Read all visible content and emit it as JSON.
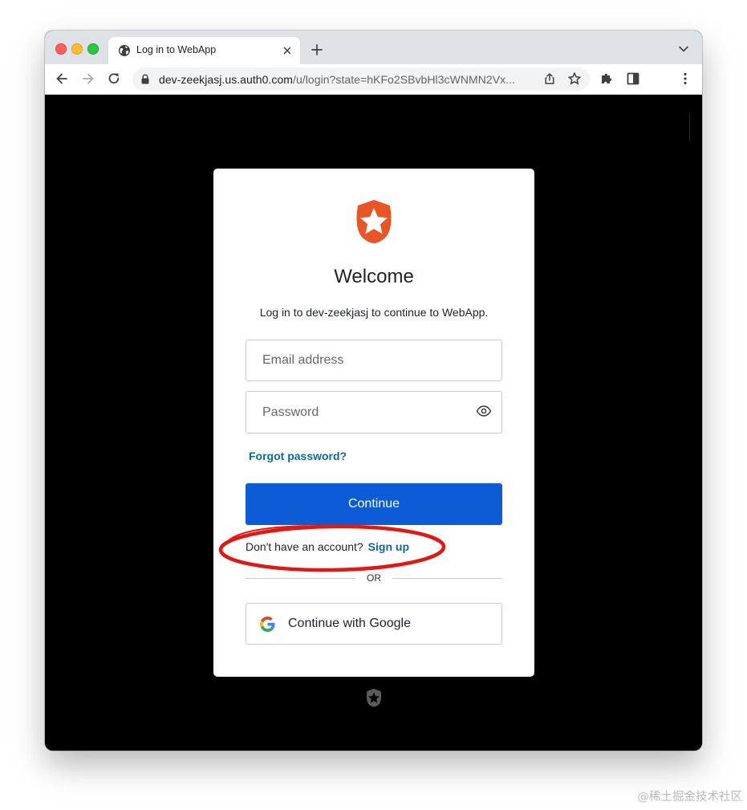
{
  "browser": {
    "tab_title": "Log in to WebApp",
    "url_host": "dev-zeekjasj.us.auth0.com",
    "url_path": "/u/login?state=hKFo2SBvbHl3cWNMN2Vx..."
  },
  "login": {
    "heading": "Welcome",
    "subtitle": "Log in to dev-zeekjasj to continue to WebApp.",
    "email_placeholder": "Email address",
    "password_placeholder": "Password",
    "forgot_label": "Forgot password?",
    "continue_label": "Continue",
    "signup_prompt": "Don't have an account?",
    "signup_label": "Sign up",
    "divider_label": "OR",
    "google_label": "Continue with Google"
  },
  "colors": {
    "brand_orange": "#eb5424",
    "primary_button": "#0b5cd6",
    "link": "#0a6aa0",
    "annotation_red": "#e8140f"
  },
  "watermark": "@稀土掘金技术社区"
}
